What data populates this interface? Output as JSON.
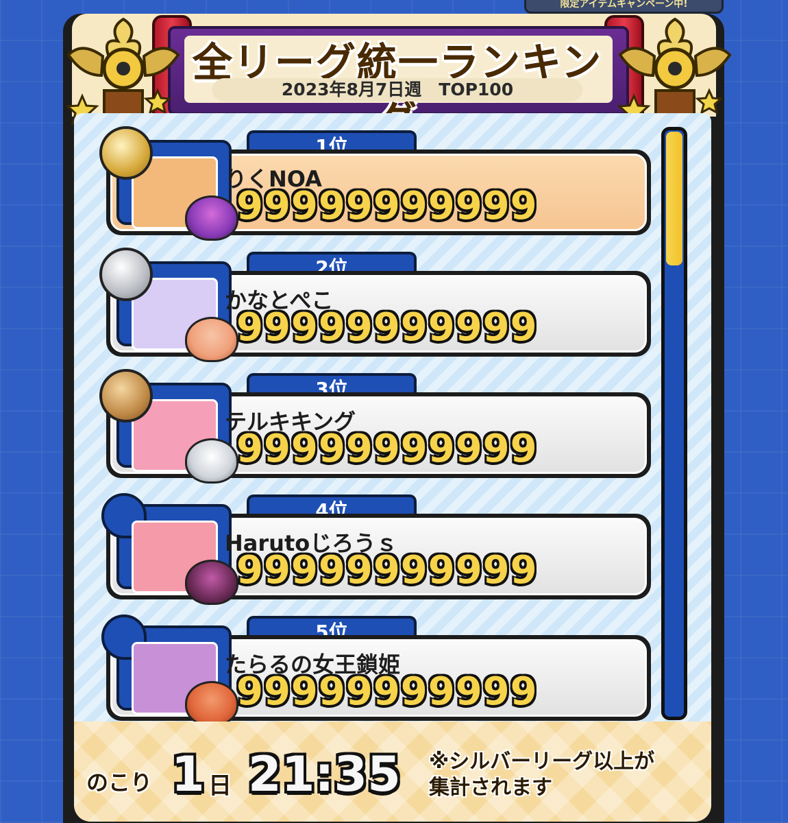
{
  "top_banner": "限定アイテムキャンペーン中!",
  "header": {
    "title": "全リーグ統一ランキング",
    "subtitle": "2023年8月7日週　TOP100"
  },
  "rankings": [
    {
      "rank": "1位",
      "name": "りくNOA",
      "score": "99999999999",
      "medal": "gold",
      "ribbon": "#d9332b",
      "avatar_color": "#f2b97b",
      "pet_color": "#8a3bb8"
    },
    {
      "rank": "2位",
      "name": "かなとぺこ",
      "score": "99999999999",
      "medal": "silver",
      "ribbon": "#2d63c7",
      "avatar_color": "#d9ccf5",
      "pet_color": "#f0a07a"
    },
    {
      "rank": "3位",
      "name": "テルキキング",
      "score": "99999999999",
      "medal": "bronze",
      "ribbon": "#2e9e48",
      "avatar_color": "#f5a0b8",
      "pet_color": "#cfd3da"
    },
    {
      "rank": "4位",
      "name": "Harutoじろうｓ",
      "score": "99999999999",
      "medal": "none",
      "ribbon": "",
      "avatar_color": "#f59aa8",
      "pet_color": "#6b2b57"
    },
    {
      "rank": "5位",
      "name": "たらるの女王鎖姫",
      "score": "99999999999",
      "medal": "none",
      "ribbon": "",
      "avatar_color": "#c890d6",
      "pet_color": "#e0663a"
    }
  ],
  "footer": {
    "remaining_label": "のこり",
    "days": "1",
    "day_unit": "日",
    "time": "21:35",
    "note_line1": "※シルバーリーグ以上が",
    "note_line2": "集計されます"
  },
  "colors": {
    "accent_blue": "#1e4fb5",
    "score_gold": "#f6d34a",
    "first_place_bg": "#f6c592"
  }
}
